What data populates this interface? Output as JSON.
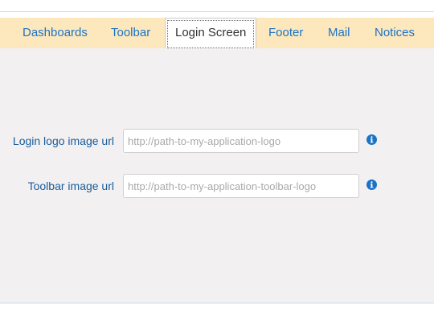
{
  "tabs": [
    {
      "label": "Dashboards",
      "active": false
    },
    {
      "label": "Toolbar",
      "active": false
    },
    {
      "label": "Login Screen",
      "active": true
    },
    {
      "label": "Footer",
      "active": false
    },
    {
      "label": "Mail",
      "active": false
    },
    {
      "label": "Notices",
      "active": false
    }
  ],
  "form": {
    "login_logo": {
      "label": "Login logo image url",
      "value": "",
      "placeholder": "http://path-to-my-application-logo",
      "info_icon": "info-icon"
    },
    "toolbar_logo": {
      "label": "Toolbar image url",
      "value": "",
      "placeholder": "http://path-to-my-application-toolbar-logo",
      "info_icon": "info-icon"
    }
  },
  "colors": {
    "tabbar_background": "#fde8be",
    "tab_text": "#1a73c6",
    "active_tab_text": "#333333",
    "label_text": "#1a5d9b",
    "content_background": "#f2f0f0",
    "info_icon": "#1a73c6"
  }
}
